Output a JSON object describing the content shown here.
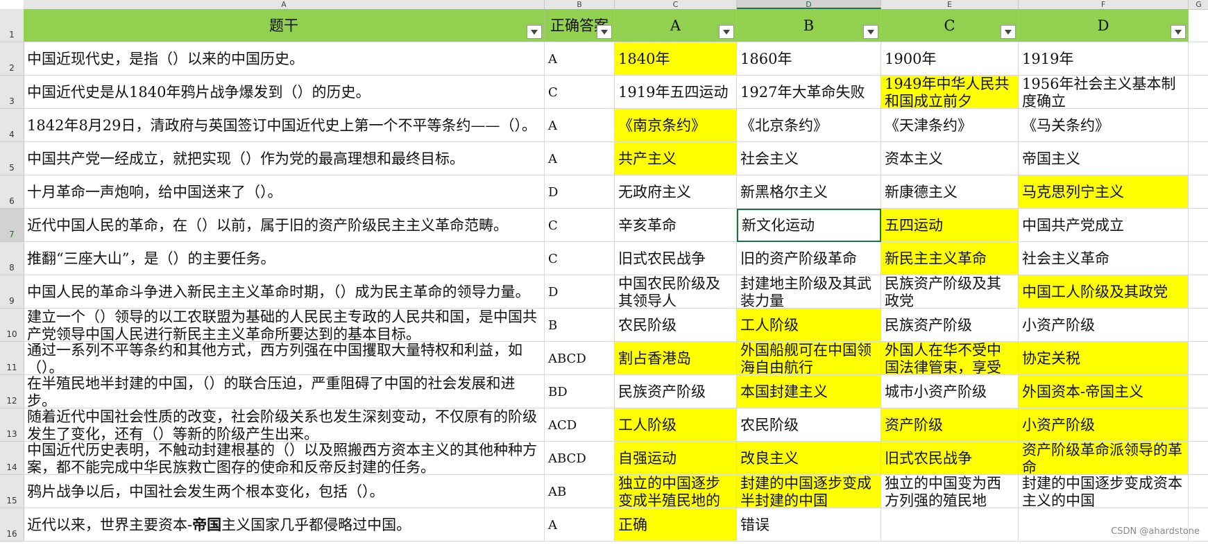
{
  "column_letters": [
    "A",
    "B",
    "C",
    "D",
    "E",
    "F",
    "G"
  ],
  "header": {
    "stem": "题干",
    "answer": "正确答案",
    "opt_a": "A",
    "opt_b": "B",
    "opt_c": "C",
    "opt_d": "D"
  },
  "rows": [
    {
      "num": "2",
      "stem": "中国近现代史，是指（）以来的中国历史。",
      "answer": "A",
      "opts": [
        "1840年",
        "1860年",
        "1900年",
        "1919年"
      ],
      "hl": [
        true,
        false,
        false,
        false
      ]
    },
    {
      "num": "3",
      "stem": "中国近代史是从1840年鸦片战争爆发到（）的历史。",
      "answer": "C",
      "opts": [
        "1919年五四运动",
        "1927年大革命失败",
        "1949年中华人民共和国成立前夕",
        "1956年社会主义基本制度确立"
      ],
      "hl": [
        false,
        false,
        true,
        false
      ]
    },
    {
      "num": "4",
      "stem": "1842年8月29日，清政府与英国签订中国近代史上第一个不平等条约——（）。",
      "answer": "A",
      "opts": [
        "《南京条约》",
        "《北京条约》",
        "《天津条约》",
        "《马关条约》"
      ],
      "hl": [
        true,
        false,
        false,
        false
      ]
    },
    {
      "num": "5",
      "stem": "中国共产党一经成立，就把实现（）作为党的最高理想和最终目标。",
      "answer": "A",
      "opts": [
        "共产主义",
        "社会主义",
        "资本主义",
        "帝国主义"
      ],
      "hl": [
        true,
        false,
        false,
        false
      ]
    },
    {
      "num": "6",
      "stem": "十月革命一声炮响，给中国送来了（）。",
      "answer": "D",
      "opts": [
        "无政府主义",
        "新黑格尔主义",
        "新康德主义",
        "马克思列宁主义"
      ],
      "hl": [
        false,
        false,
        false,
        true
      ]
    },
    {
      "num": "7",
      "stem": "近代中国人民的革命，在（）以前，属于旧的资产阶级民主主义革命范畴。",
      "answer": "C",
      "opts": [
        "辛亥革命",
        "新文化运动",
        "五四运动",
        "中国共产党成立"
      ],
      "hl": [
        false,
        false,
        true,
        false
      ]
    },
    {
      "num": "8",
      "stem": "推翻“三座大山”，是（）的主要任务。",
      "answer": "C",
      "opts": [
        "旧式农民战争",
        "旧的资产阶级革命",
        "新民主主义革命",
        "社会主义革命"
      ],
      "hl": [
        false,
        false,
        true,
        false
      ]
    },
    {
      "num": "9",
      "stem": "中国人民的革命斗争进入新民主主义革命时期，（）成为民主革命的领导力量。",
      "answer": "D",
      "opts": [
        "中国农民阶级及其领导人",
        "封建地主阶级及其武装力量",
        "民族资产阶级及其政党",
        "中国工人阶级及其政党"
      ],
      "hl": [
        false,
        false,
        false,
        true
      ]
    },
    {
      "num": "10",
      "stem": "建立一个（）领导的以工农联盟为基础的人民民主专政的人民共和国，是中国共产党领导中国人民进行新民主主义革命所要达到的基本目标。",
      "answer": "B",
      "opts": [
        "农民阶级",
        "工人阶级",
        "民族资产阶级",
        "小资产阶级"
      ],
      "hl": [
        false,
        true,
        false,
        false
      ]
    },
    {
      "num": "11",
      "stem": "通过一系列不平等条约和其他方式，西方列强在中国攫取大量特权和利益，如（）。",
      "answer": "ABCD",
      "opts": [
        "割占香港岛",
        "外国船舰可在中国领海自由航行",
        "外国人在华不受中国法律管束，享受",
        "协定关税"
      ],
      "hl": [
        true,
        true,
        true,
        true
      ]
    },
    {
      "num": "12",
      "stem": "在半殖民地半封建的中国，（）的联合压迫，严重阻碍了中国的社会发展和进步。",
      "answer": "BD",
      "opts": [
        "民族资产阶级",
        "本国封建主义",
        "城市小资产阶级",
        "外国资本-帝国主义"
      ],
      "hl": [
        false,
        true,
        false,
        true
      ]
    },
    {
      "num": "13",
      "stem": "随着近代中国社会性质的改变，社会阶级关系也发生深刻变动，不仅原有的阶级发生了变化，还有（）等新的阶级产生出来。",
      "answer": "ACD",
      "opts": [
        "工人阶级",
        "农民阶级",
        "资产阶级",
        "小资产阶级"
      ],
      "hl": [
        true,
        false,
        true,
        true
      ]
    },
    {
      "num": "14",
      "stem": "中国近代历史表明，不触动封建根基的（）以及照搬西方资本主义的其他种种方案，都不能完成中华民族救亡图存的使命和反帝反封建的任务。",
      "answer": "ABCD",
      "opts": [
        "自强运动",
        "改良主义",
        "旧式农民战争",
        "资产阶级革命派领导的革命"
      ],
      "hl": [
        true,
        true,
        true,
        true
      ]
    },
    {
      "num": "15",
      "stem": "鸦片战争以后，中国社会发生两个根本变化，包括（）。",
      "answer": "AB",
      "opts": [
        "独立的中国逐步变成半殖民地的",
        "封建的中国逐步变成半封建的中国",
        "独立的中国变为西方列强的殖民地",
        "封建的中国逐步变成资本主义的中国"
      ],
      "hl": [
        true,
        true,
        false,
        false
      ]
    },
    {
      "num": "16",
      "stem_parts": [
        "近代以来，世界主要资本-",
        "帝国",
        "主义国家几乎都侵略过中国。"
      ],
      "answer": "A",
      "opts": [
        "正确",
        "错误",
        "",
        ""
      ],
      "hl": [
        true,
        false,
        false,
        false
      ]
    }
  ],
  "watermark": "CSDN @ahardstone",
  "colors": {
    "header_green": "#92d050",
    "highlight_yellow": "#ffff00",
    "select_green": "#217346"
  },
  "icons": {
    "filter": "dropdown-arrow-icon"
  }
}
